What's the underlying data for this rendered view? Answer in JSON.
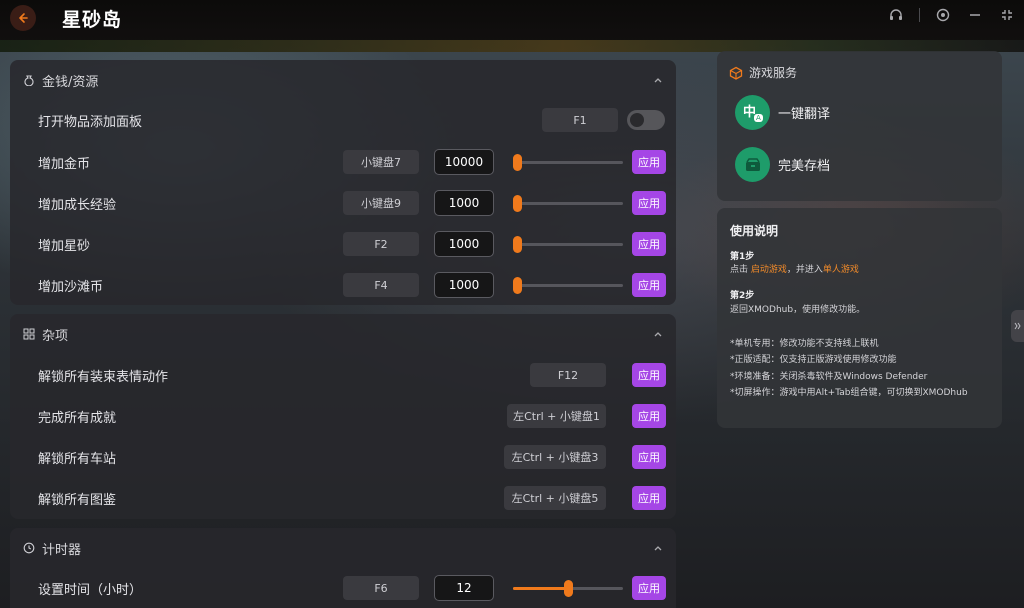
{
  "window": {
    "title": "星砂岛",
    "icons": [
      "back-arrow-icon",
      "headset-icon",
      "settings-icon",
      "minimize-icon",
      "shrink-icon"
    ],
    "accent_color": "#f07a1c",
    "apply_color": "#a546e6"
  },
  "sections": {
    "money": {
      "title": "金钱/资源",
      "icon": "coin-bag-icon",
      "rows": [
        {
          "label": "打开物品添加面板",
          "hotkey": "F1",
          "toggle_on": false
        },
        {
          "label": "增加金币",
          "hotkey": "小键盘7",
          "value": "10000",
          "slider_fraction": 0.0,
          "apply": "应用"
        },
        {
          "label": "增加成长经验",
          "hotkey": "小键盘9",
          "value": "1000",
          "slider_fraction": 0.0,
          "apply": "应用"
        },
        {
          "label": "增加星砂",
          "hotkey": "F2",
          "value": "1000",
          "slider_fraction": 0.0,
          "apply": "应用"
        },
        {
          "label": "增加沙滩币",
          "hotkey": "F4",
          "value": "1000",
          "slider_fraction": 0.0,
          "apply": "应用"
        }
      ]
    },
    "misc": {
      "title": "杂项",
      "icon": "grid-icon",
      "rows": [
        {
          "label": "解锁所有装束表情动作",
          "hotkey": "F12",
          "apply": "应用"
        },
        {
          "label": "完成所有成就",
          "hotkey": "左Ctrl + 小键盘1",
          "apply": "应用"
        },
        {
          "label": "解锁所有车站",
          "hotkey": "左Ctrl + 小键盘3",
          "apply": "应用"
        },
        {
          "label": "解锁所有图鉴",
          "hotkey": "左Ctrl + 小键盘5",
          "apply": "应用"
        }
      ]
    },
    "timer": {
      "title": "计时器",
      "icon": "clock-icon",
      "rows": [
        {
          "label": "设置时间（小时）",
          "hotkey": "F6",
          "value": "12",
          "slider_fraction": 0.5,
          "apply": "应用"
        }
      ]
    }
  },
  "services": {
    "title": "游戏服务",
    "items": [
      {
        "label": "一键翻译",
        "icon": "translate-icon",
        "badge_text": "中",
        "badge_sub": "A"
      },
      {
        "label": "完美存档",
        "icon": "save-archive-icon"
      }
    ]
  },
  "instructions": {
    "title": "使用说明",
    "step1_title": "第1步",
    "step1_pre": "点击 ",
    "step1_link1": "启动游戏",
    "step1_mid": "，并进入",
    "step1_link2": "单人游戏",
    "step2_title": "第2步",
    "step2_text": "返回XMODhub，使用修改功能。",
    "notes": [
      "*单机专用：修改功能不支持线上联机",
      "*正版适配：仅支持正版游戏使用修改功能",
      "*环境准备：关闭杀毒软件及Windows Defender",
      "*切屏操作：游戏中用Alt+Tab组合键，可切换到XMODhub"
    ]
  }
}
